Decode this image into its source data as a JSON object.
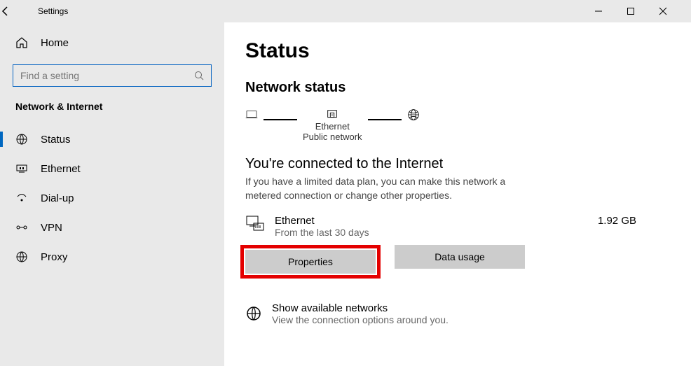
{
  "titlebar": {
    "title": "Settings"
  },
  "sidebar": {
    "home": "Home",
    "search_placeholder": "Find a setting",
    "section": "Network & Internet",
    "items": [
      {
        "label": "Status"
      },
      {
        "label": "Ethernet"
      },
      {
        "label": "Dial-up"
      },
      {
        "label": "VPN"
      },
      {
        "label": "Proxy"
      }
    ]
  },
  "main": {
    "page_title": "Status",
    "subtitle": "Network status",
    "diagram": {
      "adapter": "Ethernet",
      "profile": "Public network"
    },
    "connected_heading": "You're connected to the Internet",
    "connected_desc": "If you have a limited data plan, you can make this network a metered connection or change other properties.",
    "connection": {
      "name": "Ethernet",
      "sub": "From the last 30 days",
      "usage": "1.92 GB"
    },
    "buttons": {
      "properties": "Properties",
      "data_usage": "Data usage"
    },
    "link": {
      "title": "Show available networks",
      "sub": "View the connection options around you."
    }
  }
}
